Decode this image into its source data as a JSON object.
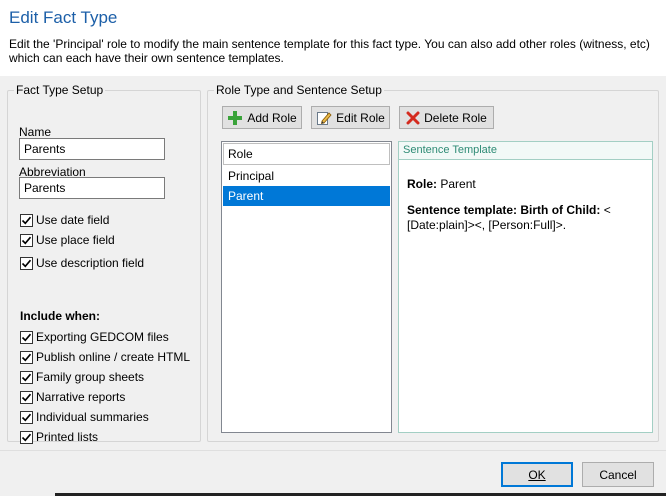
{
  "dialog": {
    "title": "Edit Fact Type",
    "description": "Edit the 'Principal' role to modify the main sentence template for this fact type.  You can also add other roles (witness, etc) which can each have their own sentence templates."
  },
  "fact_type_setup": {
    "title": "Fact Type Setup",
    "name_label": "Name",
    "name_value": "Parents",
    "abbreviation_label": "Abbreviation",
    "abbreviation_value": "Parents",
    "field_options": [
      {
        "label": "Use date field",
        "checked": true
      },
      {
        "label": "Use place field",
        "checked": true
      },
      {
        "label": "Use description field",
        "checked": true
      }
    ],
    "include_when_label": "Include when:",
    "include_options": [
      {
        "label": "Exporting GEDCOM files",
        "checked": true
      },
      {
        "label": "Publish online / create HTML",
        "checked": true
      },
      {
        "label": "Family group sheets",
        "checked": true
      },
      {
        "label": "Narrative reports",
        "checked": true
      },
      {
        "label": "Individual summaries",
        "checked": true
      },
      {
        "label": "Printed lists",
        "checked": true
      }
    ]
  },
  "role_setup": {
    "title": "Role Type and Sentence Setup",
    "toolbar": {
      "add_role_label": "Add Role",
      "edit_role_label": "Edit Role",
      "delete_role_label": "Delete Role"
    },
    "list_header": "Role",
    "roles": [
      "Principal",
      "Parent"
    ],
    "selected_role": "Parent",
    "template_header": "Sentence Template",
    "role_caption": "Role:",
    "role_value": "Parent",
    "sentence_caption": "Sentence template: Birth of Child:",
    "sentence_value_line1": "<",
    "sentence_value_line2": "[Date:plain]><, [Person:Full]>."
  },
  "footer": {
    "ok_label": "OK",
    "cancel_label": "Cancel"
  },
  "colors": {
    "title": "#1c5fa8",
    "selection": "#0078d7",
    "template_border": "#a3cfc4",
    "template_header_text": "#2e8b75"
  },
  "icons": {
    "add": "plus-icon",
    "edit": "pencil-icon",
    "delete": "red-x-icon",
    "check": "checkmark-icon"
  }
}
